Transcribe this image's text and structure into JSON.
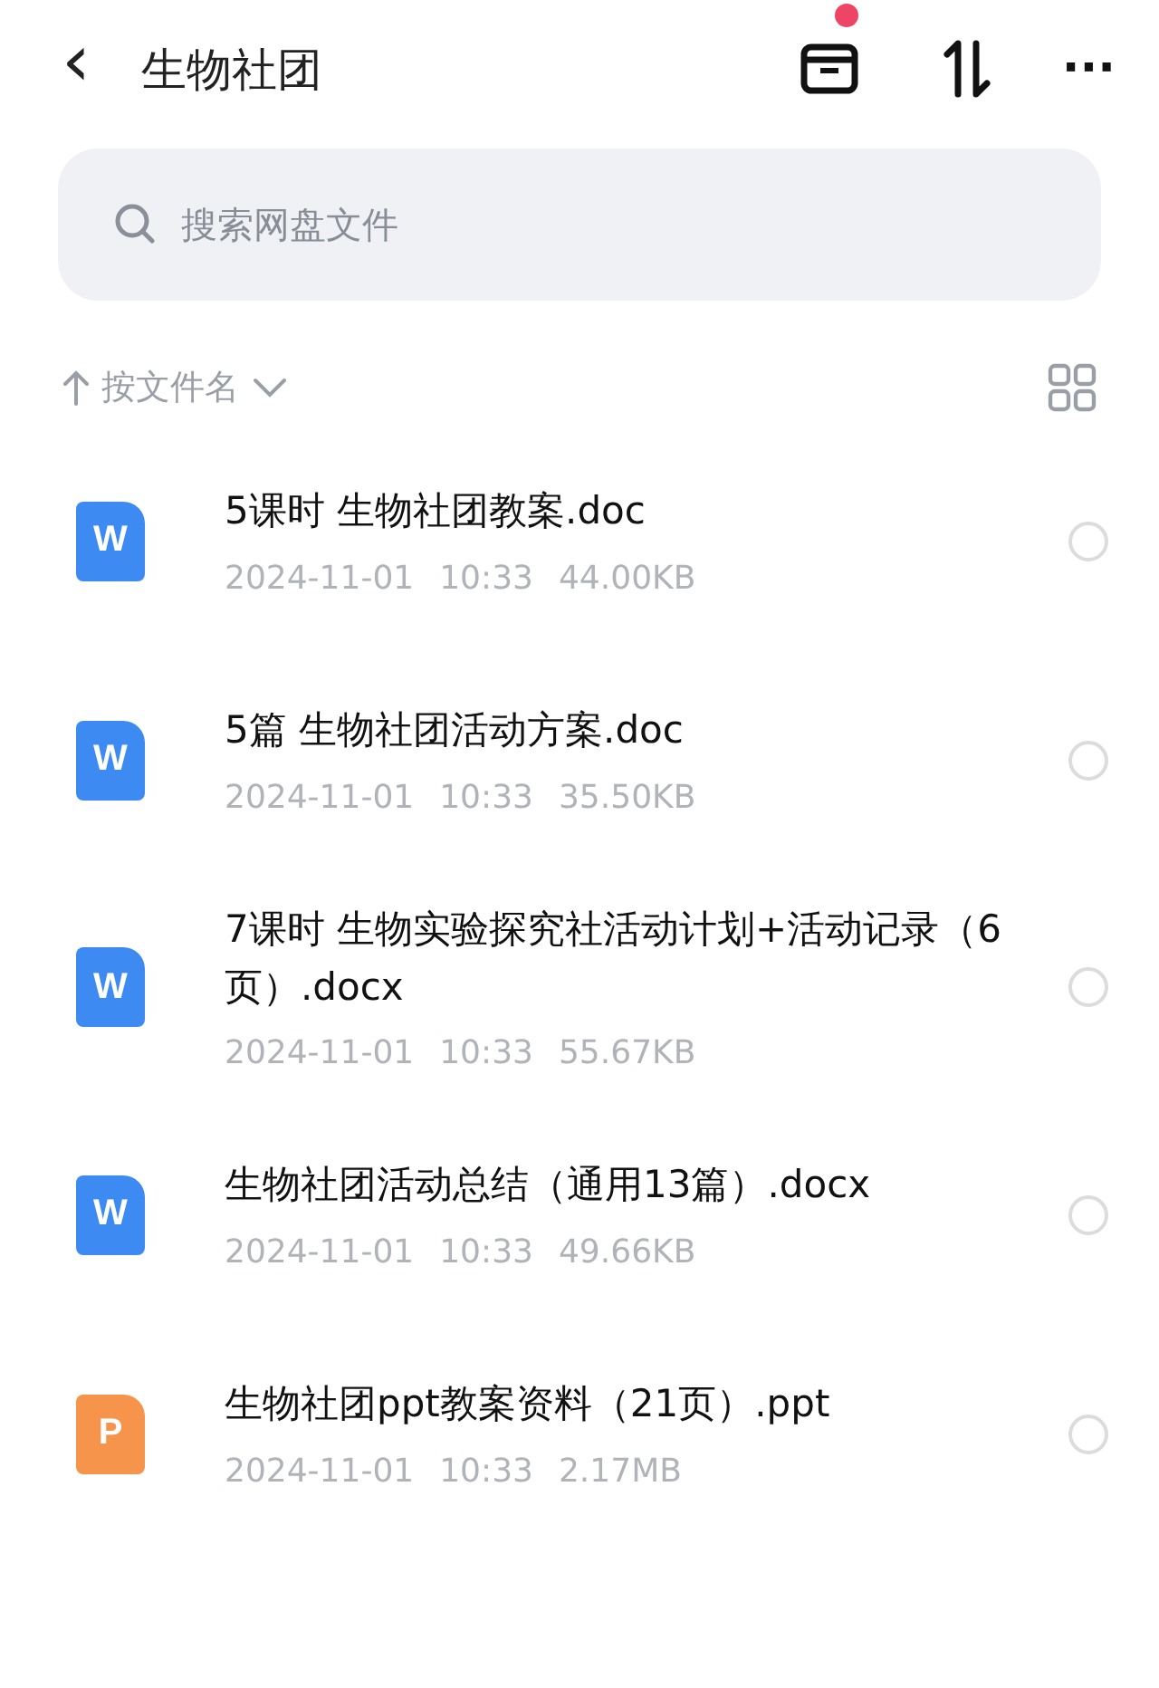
{
  "header": {
    "back": "‹",
    "title": "生物社团",
    "more": "···"
  },
  "search": {
    "placeholder": "搜索网盘文件"
  },
  "sort": {
    "label": "按文件名"
  },
  "files": [
    {
      "kind": "word",
      "badge": "W",
      "name": "5课时 生物社团教案.doc",
      "date": "2024-11-01",
      "time": "10:33",
      "size": "44.00KB",
      "selected": false
    },
    {
      "kind": "word",
      "badge": "W",
      "name": "5篇 生物社团活动方案.doc",
      "date": "2024-11-01",
      "time": "10:33",
      "size": "35.50KB",
      "selected": false
    },
    {
      "kind": "word",
      "badge": "W",
      "name": "7课时 生物实验探究社活动计划+活动记录（6页）.docx",
      "date": "2024-11-01",
      "time": "10:33",
      "size": "55.67KB",
      "selected": false
    },
    {
      "kind": "word",
      "badge": "W",
      "name": "生物社团活动总结（通用13篇）.docx",
      "date": "2024-11-01",
      "time": "10:33",
      "size": "49.66KB",
      "selected": false
    },
    {
      "kind": "ppt",
      "badge": "P",
      "name": "生物社团ppt教案资料（21页）.ppt",
      "date": "2024-11-01",
      "time": "10:33",
      "size": "2.17MB",
      "selected": false
    }
  ]
}
